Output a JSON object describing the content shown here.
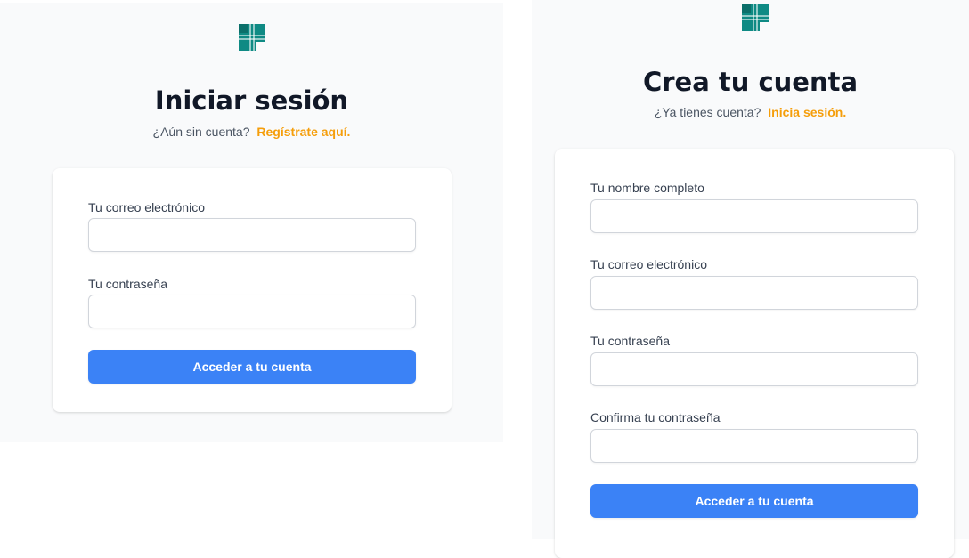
{
  "brand": {
    "logo_icon": "teal-grid-logo-icon",
    "logo_color": "#0f8a84",
    "accent_color": "#f59e0b",
    "primary_color": "#3b82f6"
  },
  "login": {
    "title": "Iniciar sesión",
    "prompt_text": "¿Aún sin cuenta?",
    "prompt_link": "Regístrate aquí.",
    "email_label": "Tu correo electrónico",
    "email_value": "",
    "password_label": "Tu contraseña",
    "password_value": "",
    "submit_label": "Acceder a tu cuenta"
  },
  "register": {
    "title": "Crea tu cuenta",
    "prompt_text": "¿Ya tienes cuenta?",
    "prompt_link": "Inicia sesión.",
    "name_label": "Tu nombre completo",
    "name_value": "",
    "email_label": "Tu correo electrónico",
    "email_value": "",
    "password_label": "Tu contraseña",
    "password_value": "",
    "confirm_label": "Confirma tu contraseña",
    "confirm_value": "",
    "submit_label": "Acceder a tu cuenta"
  }
}
